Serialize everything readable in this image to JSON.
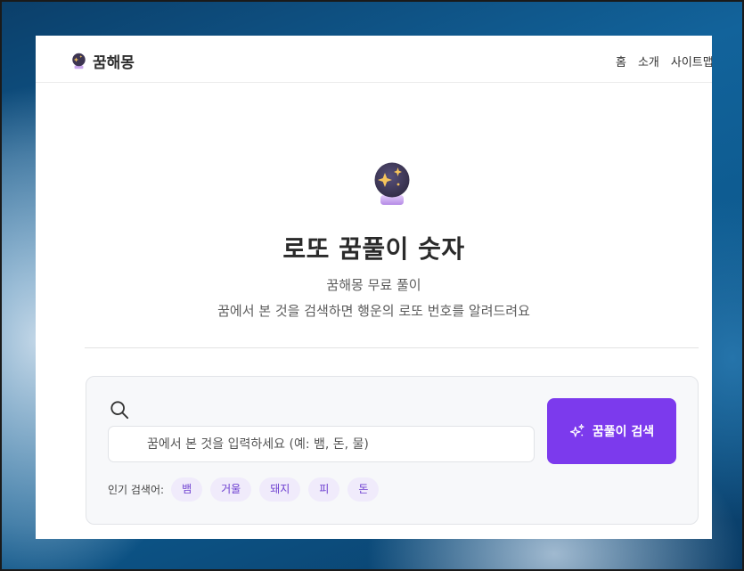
{
  "header": {
    "logo_text": "꿈해몽",
    "nav": [
      "홈",
      "소개",
      "사이트맵"
    ]
  },
  "hero": {
    "title": "로또 꿈풀이 숫자",
    "subtitle": "꿈해몽 무료 풀이",
    "description": "꿈에서 본 것을 검색하면 행운의 로또 번호를 알려드려요"
  },
  "search": {
    "placeholder": "꿈에서 본 것을 입력하세요 (예: 뱀, 돈, 물)",
    "value": "",
    "button_label": "꿈풀이 검색",
    "popular_label": "인기 검색어:",
    "popular_tags": [
      "뱀",
      "거울",
      "돼지",
      "피",
      "돈"
    ]
  },
  "colors": {
    "accent": "#7c3aed",
    "tag_bg": "#f0ebfb",
    "tag_text": "#6d3fd0"
  },
  "icons": {
    "logo": "crystal-ball-icon",
    "hero": "crystal-ball-icon",
    "search": "search-icon",
    "button": "sparkles-icon"
  }
}
